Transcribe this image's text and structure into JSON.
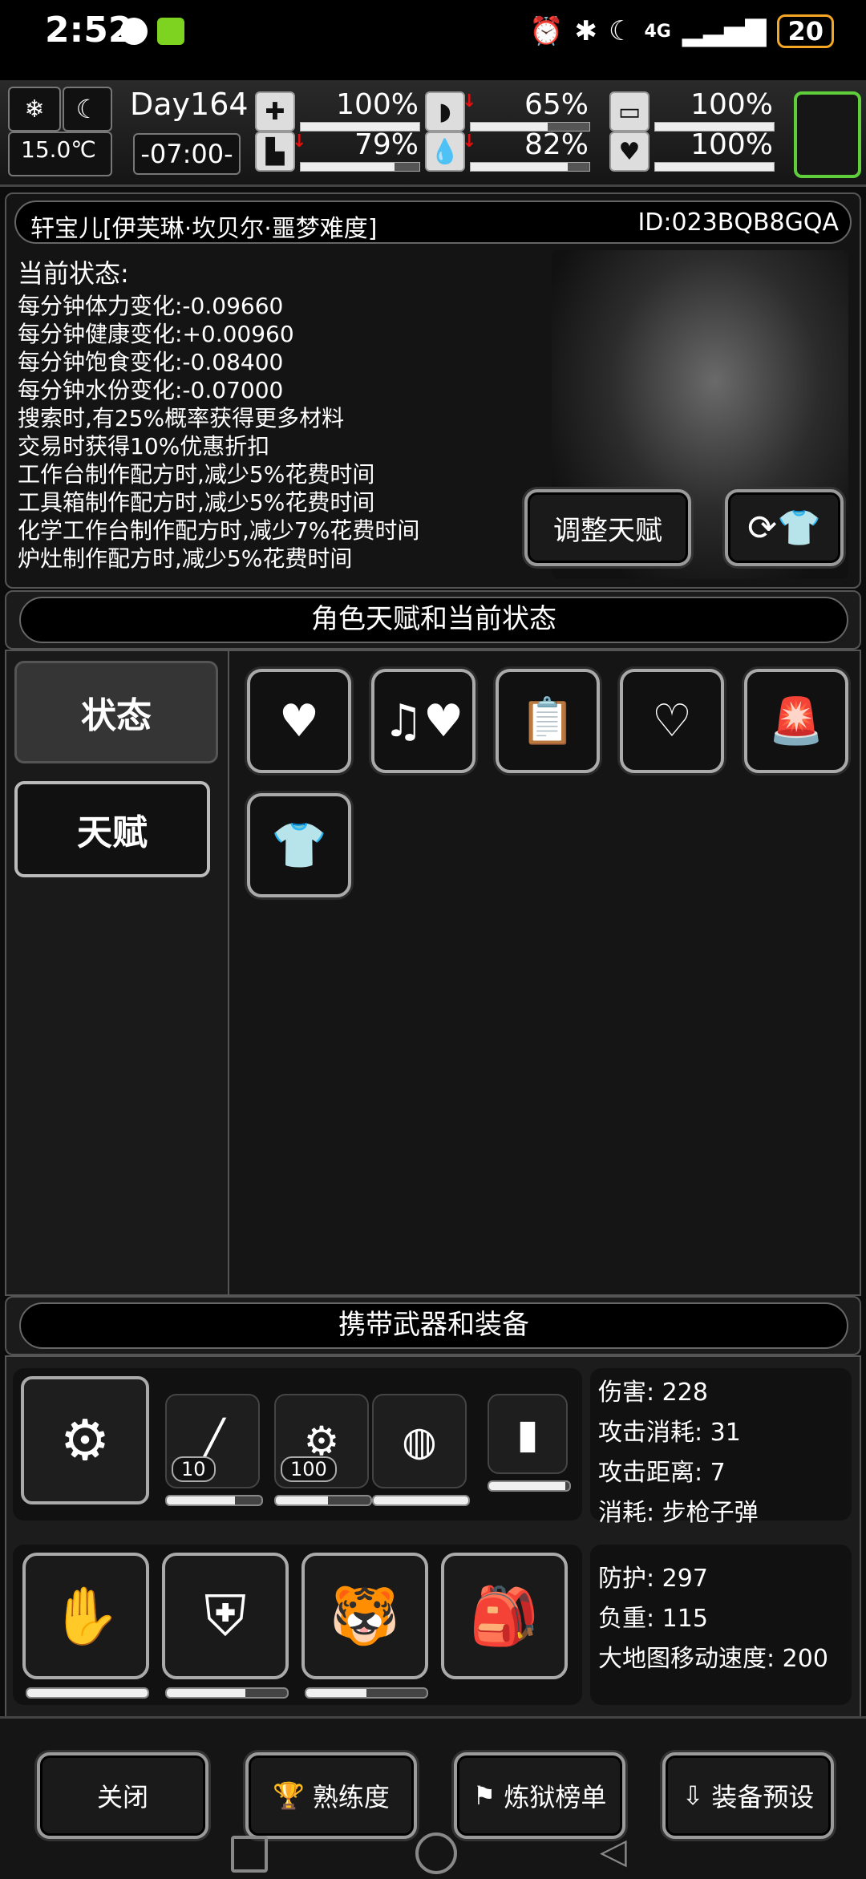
{
  "status_bar": {
    "time": "2:52",
    "battery": "20",
    "network": "4G"
  },
  "top": {
    "weather_icon": "snow-weather-icon",
    "moon_icon": "moon-icon",
    "temperature": "15.0℃",
    "day": "Day164",
    "clock": "-07:00-",
    "stats": [
      {
        "icon": "medkit-icon",
        "value": "100%",
        "level": 1.0
      },
      {
        "icon": "stomach-icon",
        "value": "65%",
        "level": 0.65,
        "down": true
      },
      {
        "icon": "pill-icon",
        "value": "100%",
        "level": 1.0
      },
      {
        "icon": "boot-icon",
        "value": "79%",
        "level": 0.79,
        "down": true
      },
      {
        "icon": "water-drop-icon",
        "value": "82%",
        "level": 0.82,
        "down": true
      },
      {
        "icon": "heart-icon",
        "value": "100%",
        "level": 1.0
      }
    ]
  },
  "character": {
    "name": "轩宝儿[伊芙琳·坎贝尔·噩梦难度]",
    "id": "ID:023BQB8GQA",
    "status_title": "当前状态:",
    "status_lines": [
      "每分钟体力变化:-0.09660",
      "每分钟健康变化:+0.00960",
      "每分钟饱食变化:-0.08400",
      "每分钟水份变化:-0.07000",
      "搜索时,有25%概率获得更多材料",
      "交易时获得10%优惠折扣",
      "工作台制作配方时,减少5%花费时间",
      "工具箱制作配方时,减少5%花费时间",
      "化学工作台制作配方时,减少7%花费时间",
      "炉灶制作配方时,减少5%花费时间"
    ],
    "adjust_talent": "调整天赋"
  },
  "talent_section": {
    "title": "角色天赋和当前状态",
    "tabs": [
      "状态",
      "天赋"
    ],
    "icons": [
      "heart-icon",
      "music-heart-icon",
      "medical-report-pill-icon",
      "stomach-heart-icon",
      "alarm-person-icon",
      "shirt-icon"
    ]
  },
  "equip_section": {
    "title": "携带武器和装备",
    "weapons": [
      {
        "icon": "minigun-icon",
        "level": 1.0
      },
      {
        "icon": "rifle-icon",
        "count": "10",
        "level": 0.72
      },
      {
        "icon": "minigun-icon",
        "count": "100",
        "level": 0.55
      },
      {
        "icon": "net-trap-icon",
        "level": 1.0
      },
      {
        "icon": "riot-shield-icon",
        "level": 0.95
      }
    ],
    "weapon_stats": [
      "伤害: 228",
      "攻击消耗: 31",
      "攻击距离: 7",
      "消耗: 步枪子弹"
    ],
    "armor": [
      {
        "icon": "arm-guards-icon",
        "level": 1.0
      },
      {
        "icon": "body-armor-icon",
        "level": 0.65
      },
      {
        "icon": "tiger-hat-icon",
        "level": 0.5
      },
      {
        "icon": "backpack-icon",
        "level": 0
      }
    ],
    "armor_stats": [
      "防护: 297",
      "负重: 115",
      "大地图移动速度: 200"
    ]
  },
  "bottom_buttons": [
    "关闭",
    "熟练度",
    "炼狱榜单",
    "装备预设"
  ]
}
